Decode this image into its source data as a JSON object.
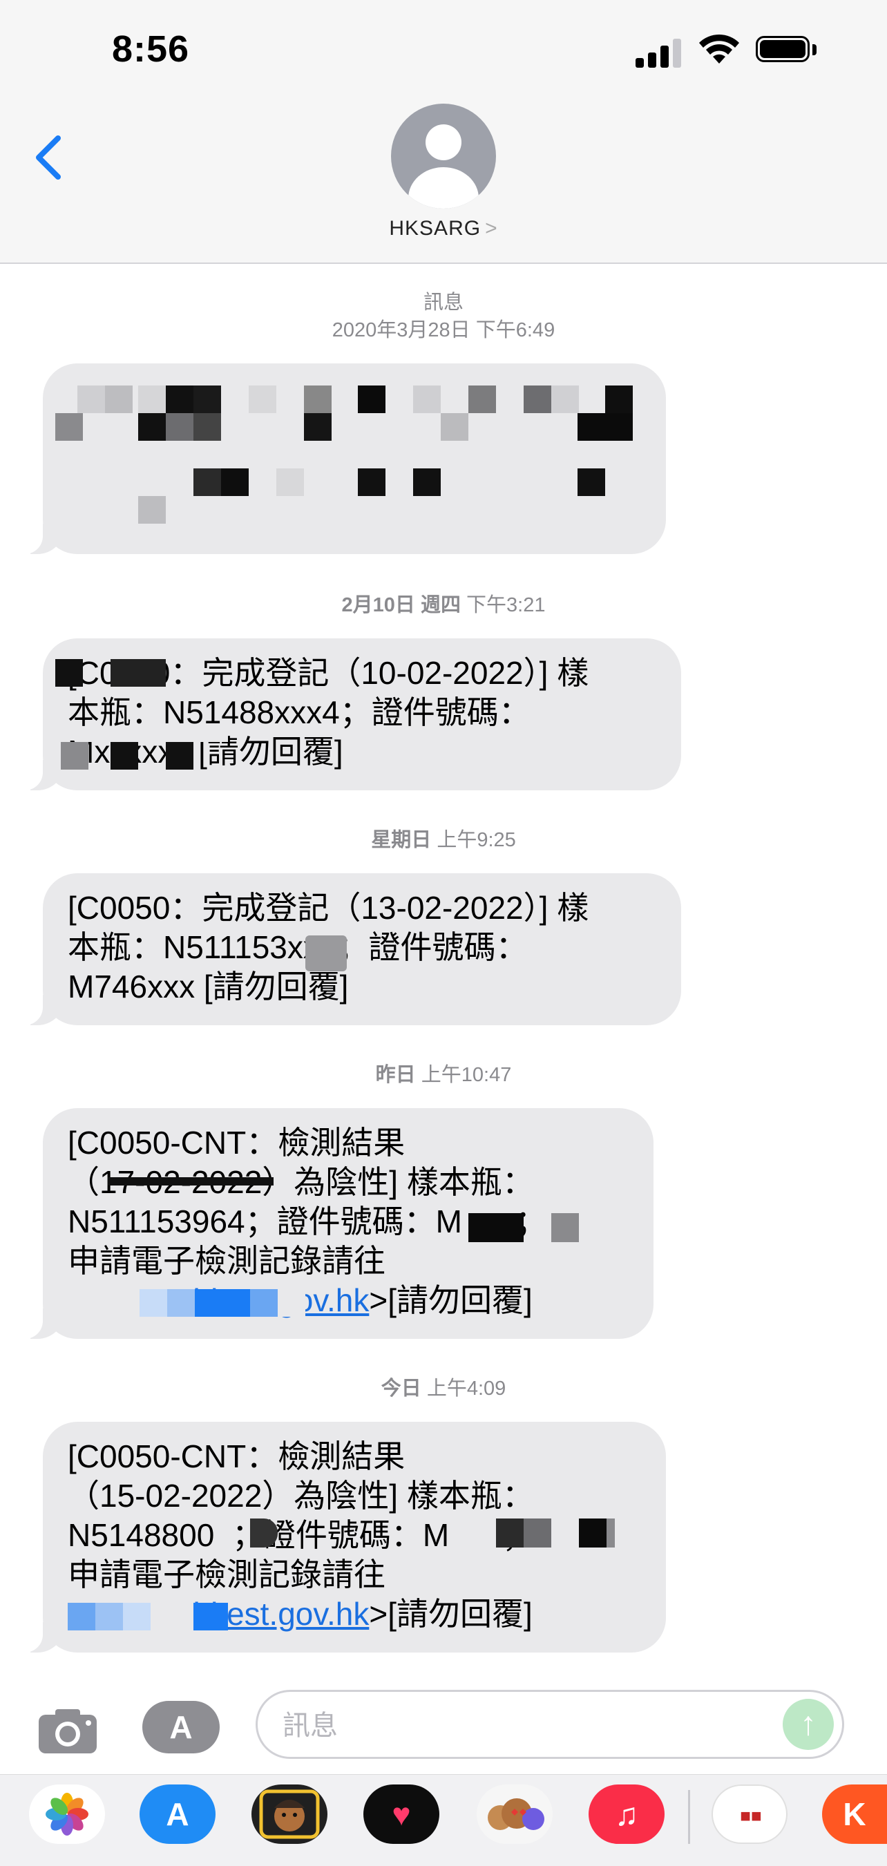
{
  "status_bar": {
    "time": "8:56"
  },
  "header": {
    "contact_name": "HKSARG",
    "contact_chevron": ">"
  },
  "thread": {
    "label": "訊息",
    "messages": [
      {
        "timestamp_day": "2020年3月28日",
        "timestamp_time": "下午6:49",
        "text": ""
      },
      {
        "timestamp_day": "2月10日 週四",
        "timestamp_time": "下午3:21",
        "text": "[C0050：完成登記（10-02-2022）] 樣\n本瓶：N51488xxx4；證件號碼：\nMxxxxxx [請勿回覆]"
      },
      {
        "timestamp_day": "星期日",
        "timestamp_time": "上午9:25",
        "text": "[C0050：完成登記（13-02-2022）] 樣\n本瓶：N511153xx4；證件號碼：\nM746xxx [請勿回覆]"
      },
      {
        "timestamp_day": "昨日",
        "timestamp_time": "上午10:47",
        "text_line1": "[C0050-CNT：檢測結果",
        "text_line2": "（17-02-2022）為陰性] 樣本瓶：",
        "text_line3": "N511153964；證件號碼：M      ；",
        "text_line4": "申請電子檢測記錄請往",
        "link_text": "www.covidtest.gov.hk",
        "text_tail": ">[請勿回覆]"
      },
      {
        "timestamp_day": "今日",
        "timestamp_time": "上午4:09",
        "text_line1": "[C0050-CNT：檢測結果",
        "text_line2": "（15-02-2022）為陰性] 樣本瓶：",
        "text_line3": "N5148800  ；證件號碼：M      ；",
        "text_line4": "申請電子檢測記錄請往",
        "link_text": "www.covidtest.gov.hk",
        "text_tail": ">[請勿回覆]"
      }
    ]
  },
  "compose": {
    "placeholder": "訊息"
  },
  "app_drawer": {
    "apps": [
      "photos-icon",
      "app-store-icon",
      "memoji-icon",
      "digital-touch-icon",
      "memoji-stickers-icon",
      "music-icon",
      "calendar-app-icon",
      "klook-icon"
    ]
  },
  "colors": {
    "bubble": "#e9e9eb",
    "link": "#1a6fe0",
    "accent": "#1a7cf5"
  }
}
